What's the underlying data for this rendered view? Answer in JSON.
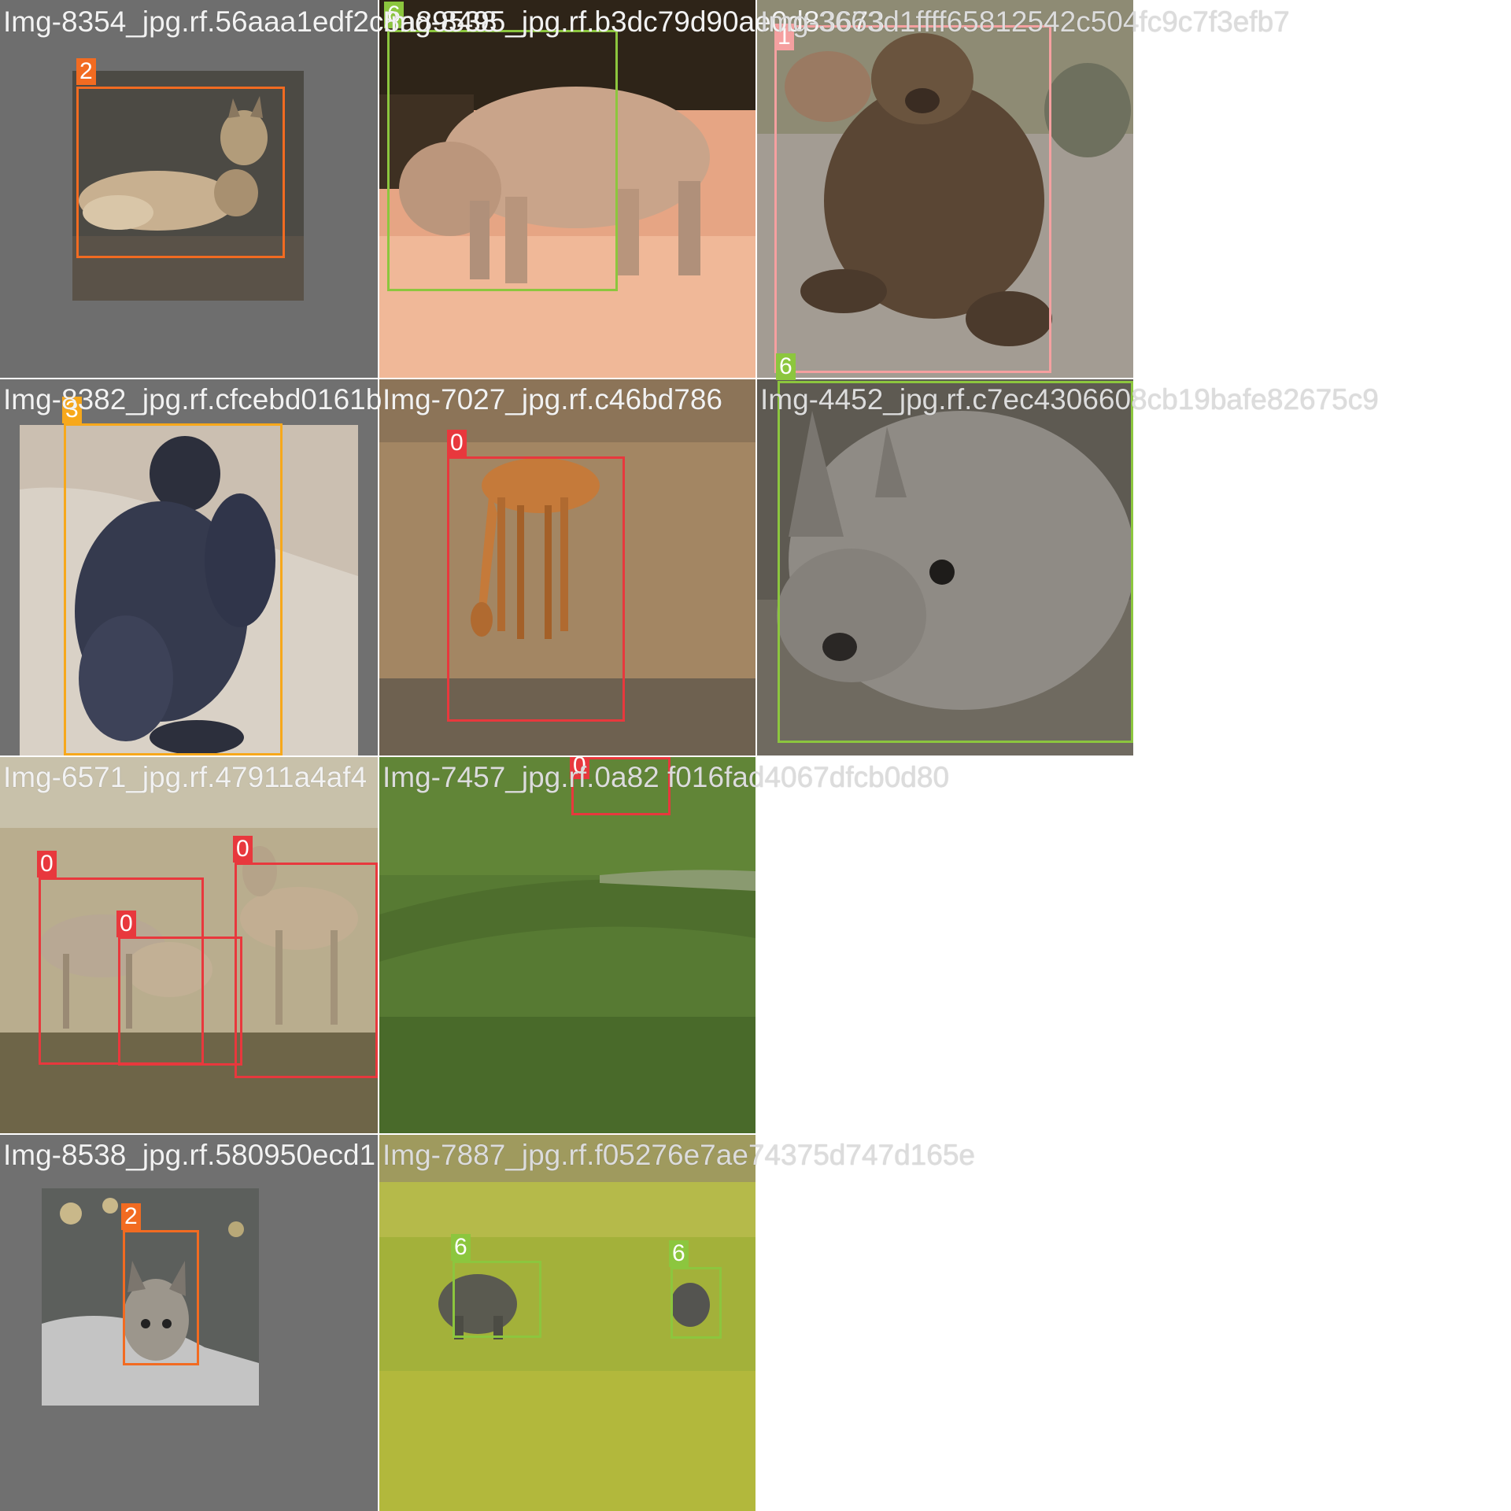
{
  "mosaic": {
    "tiles": [
      {
        "filename": "Img-8354_jpg.rf.56aaa1edf2c8a89538",
        "subject": "lynx",
        "boxes": [
          {
            "label": "2",
            "color": "#f26b21"
          }
        ]
      },
      {
        "filename": "Img-8495_jpg.rf.b3dc79d90ae0d83673",
        "subject": "rhinoceros",
        "boxes": [
          {
            "label": "6",
            "color": "#8cc63e"
          }
        ]
      },
      {
        "filename": "Img-3663d1ffff65812542c504fc9c7f3efb7",
        "subject": "bear",
        "boxes": [
          {
            "label": "1",
            "color": "#f5a0a0"
          }
        ]
      },
      {
        "filename": "Img-8382_jpg.rf.cfcebd0161b",
        "subject": "chimpanzee",
        "boxes": [
          {
            "label": "3",
            "color": "#f7a81b"
          }
        ]
      },
      {
        "filename": "Img-7027_jpg.rf.c46bd786",
        "subject": "impala",
        "boxes": [
          {
            "label": "0",
            "color": "#e8383d"
          }
        ]
      },
      {
        "filename": "Img-4452_jpg.rf.c7ec4306608cb19bafe82675c9",
        "subject": "rhinoceros head",
        "boxes": [
          {
            "label": "6",
            "color": "#8cc63e"
          }
        ]
      },
      {
        "filename": "Img-6571_jpg.rf.47911a4af4",
        "subject": "antelopes",
        "boxes": [
          {
            "label": "0",
            "color": "#e8383d"
          },
          {
            "label": "0",
            "color": "#e8383d"
          },
          {
            "label": "0",
            "color": "#e8383d"
          }
        ]
      },
      {
        "filename": "Img-7457_jpg.rf.0a82 f016fad4067dfcb0d80",
        "subject": "grassland",
        "boxes": [
          {
            "label": "0",
            "color": "#e8383d"
          }
        ]
      },
      {
        "filename": "Img-8538_jpg.rf.580950ecd1",
        "subject": "lynx",
        "boxes": [
          {
            "label": "2",
            "color": "#f26b21"
          }
        ]
      },
      {
        "filename": "Img-7887_jpg.rf.f05276e7ae74375d747d165e",
        "subject": "rhinoceroses",
        "boxes": [
          {
            "label": "6",
            "color": "#8cc63e"
          },
          {
            "label": "6",
            "color": "#8cc63e"
          }
        ]
      }
    ],
    "class_colors": {
      "0": "#e8383d",
      "1": "#f5a0a0",
      "2": "#f26b21",
      "3": "#f7a81b",
      "6": "#8cc63e"
    }
  }
}
